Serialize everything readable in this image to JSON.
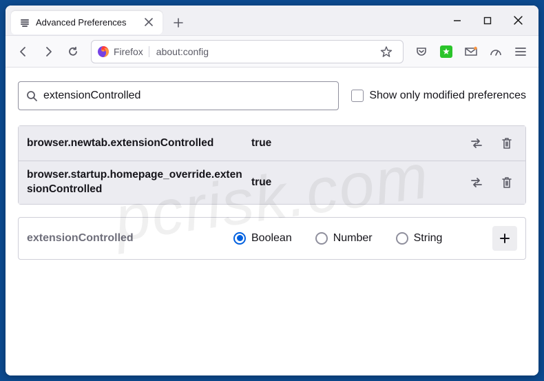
{
  "window": {
    "tab_title": "Advanced Preferences"
  },
  "toolbar": {
    "identity_label": "Firefox",
    "url": "about:config"
  },
  "search": {
    "value": "extensionControlled",
    "modified_only_label": "Show only modified preferences"
  },
  "prefs": [
    {
      "name": "browser.newtab.extensionControlled",
      "value": "true"
    },
    {
      "name": "browser.startup.homepage_override.extensionControlled",
      "value": "true"
    }
  ],
  "new_pref": {
    "name": "extensionControlled",
    "types": [
      "Boolean",
      "Number",
      "String"
    ],
    "selected": "Boolean"
  },
  "watermark": "pcrisk.com"
}
